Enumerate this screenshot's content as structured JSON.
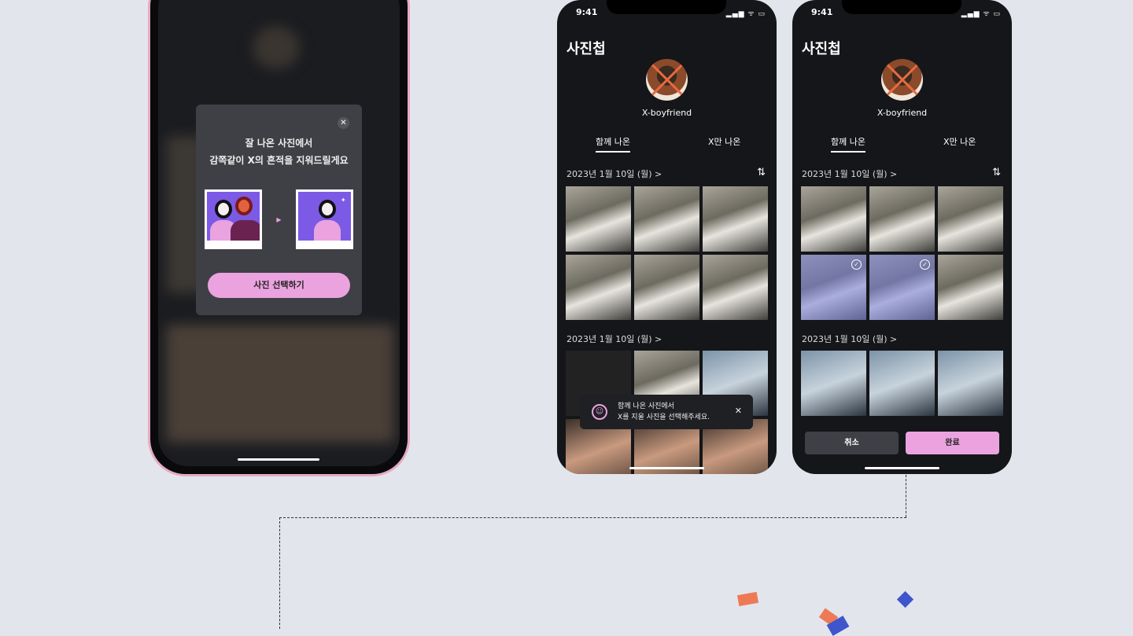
{
  "modal": {
    "line1": "잘 나온 사진에서",
    "line2": "감쪽같이 X의 흔적을 지워드릴게요",
    "button": "사진 선택하기",
    "close": "✕"
  },
  "status": {
    "time": "9:41",
    "icons": "▂▄▆ ᯤ ▭"
  },
  "album": {
    "title": "사진첩",
    "profile_name": "X-boyfriend",
    "tabs": [
      "함께 나온",
      "X만 나온"
    ],
    "sections": [
      {
        "date": "2023년 1월 10일 (월)  >"
      },
      {
        "date": "2023년 1월 10일 (월)  >"
      }
    ],
    "sort_icon": "⇅"
  },
  "toast": {
    "line1": "함께 나온 사진에서",
    "line2": "X를 지울 사진을 선택해주세요.",
    "close": "✕",
    "icon": "☺"
  },
  "selection": {
    "cancel": "취소",
    "done": "완료",
    "check": "✓"
  },
  "colors": {
    "accent": "#eba3df",
    "background": "#e3e5ec",
    "phone_frame": "#e7a9c4"
  }
}
